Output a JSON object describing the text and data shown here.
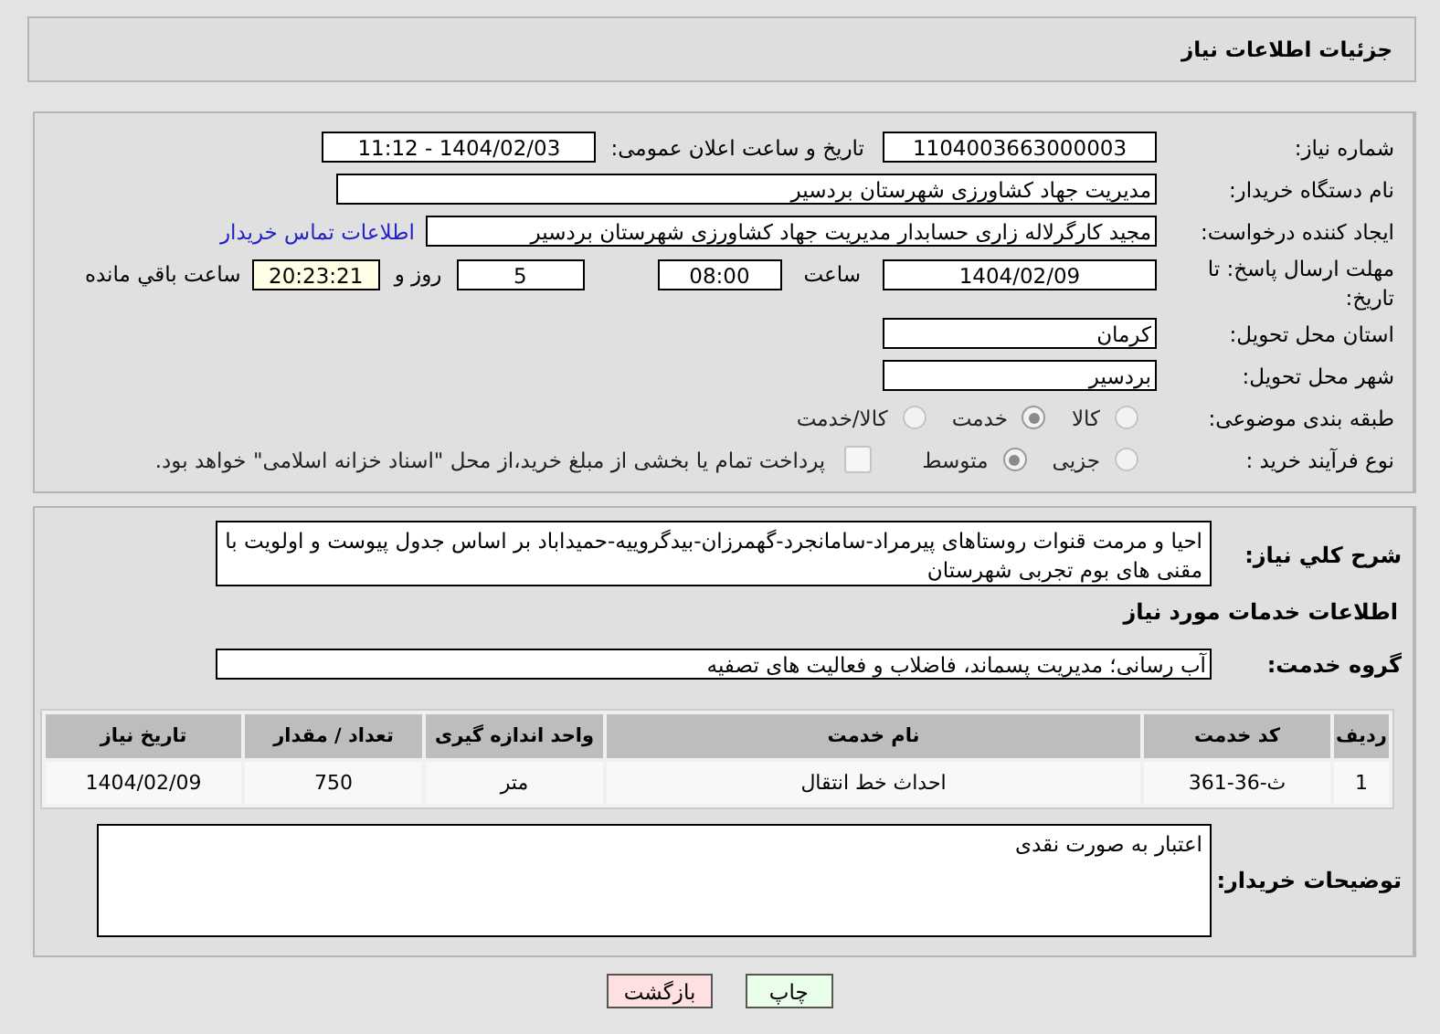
{
  "header": {
    "title": "جزئیات اطلاعات نیاز"
  },
  "need_number": {
    "label": "شماره نیاز:",
    "value": "1104003663000003"
  },
  "announce": {
    "label": "تاریخ و ساعت اعلان عمومی:",
    "value": "1404/02/03 - 11:12"
  },
  "buyer_org": {
    "label": "نام دستگاه خریدار:",
    "value": "مدیریت جهاد کشاورزی شهرستان بردسیر"
  },
  "creator": {
    "label": "ایجاد کننده درخواست:",
    "value": "مجید کارگرلاله زاری حسابدار مدیریت جهاد کشاورزی شهرستان بردسیر",
    "link": "اطلاعات تماس خریدار"
  },
  "deadline": {
    "label": "مهلت ارسال پاسخ: تا تاریخ:",
    "date": "1404/02/09",
    "time_label": "ساعت",
    "time": "08:00",
    "days": "5",
    "days_label": "روز و",
    "remaining": "20:23:21",
    "remaining_label": "ساعت باقي مانده"
  },
  "province": {
    "label": "استان محل تحویل:",
    "value": "کرمان"
  },
  "city": {
    "label": "شهر محل تحویل:",
    "value": "بردسیر"
  },
  "category": {
    "label": "طبقه بندی موضوعی:",
    "options": [
      {
        "label": "کالا",
        "selected": false
      },
      {
        "label": "خدمت",
        "selected": true
      },
      {
        "label": "کالا/خدمت",
        "selected": false
      }
    ]
  },
  "process": {
    "label": "نوع فرآیند خرید :",
    "options": [
      {
        "label": "جزیی",
        "selected": false
      },
      {
        "label": "متوسط",
        "selected": true
      }
    ],
    "treasury": {
      "label": "پرداخت تمام یا بخشی از مبلغ خرید،از محل \"اسناد خزانه اسلامی\" خواهد بود.",
      "checked": false
    }
  },
  "description": {
    "label": "شرح کلي نياز:",
    "value": "احیا و مرمت   قنوات روستاهای پیرمراد-سامانجرد-گهمرزان-بیدگروییه-حمیداباد بر اساس جدول پیوست و اولویت با مقنی های بوم تجربی شهرستان"
  },
  "services_heading": "اطلاعات خدمات مورد نیاز",
  "service_group": {
    "label": "گروه خدمت:",
    "value": "آب رسانی؛ مدیریت پسماند، فاضلاب و فعالیت های تصفیه"
  },
  "table": {
    "columns": [
      "ردیف",
      "کد خدمت",
      "نام خدمت",
      "واحد اندازه گیری",
      "تعداد / مقدار",
      "تاریخ نیاز"
    ],
    "rows": [
      [
        "1",
        "ث-36-361",
        "احداث خط انتقال",
        "متر",
        "750",
        "1404/02/09"
      ]
    ]
  },
  "buyer_notes": {
    "label": "توضیحات خریدار:",
    "value": "اعتبار به صورت نقدی"
  },
  "buttons": [
    {
      "label": "چاپ",
      "kind": "print"
    },
    {
      "label": "بازگشت",
      "kind": "back"
    }
  ]
}
